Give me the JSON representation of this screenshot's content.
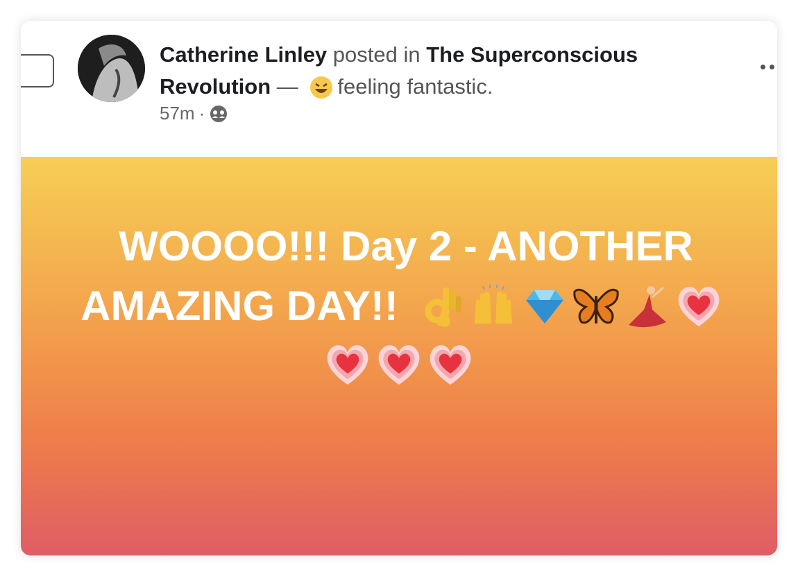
{
  "post": {
    "author": "Catherine Linley",
    "posted_in_text": " posted in ",
    "group": "The Superconscious Revolution",
    "dash": " — ",
    "feeling": "feeling fantastic.",
    "time": "57m",
    "separator": "·",
    "audience_icon": "group-audience-icon",
    "feeling_icon": "grinning-face-icon",
    "more_icon": "more-options-icon"
  },
  "status": {
    "line1": "WOOOO!!! Day 2 - ANOTHER",
    "line2": "AMAZING DAY!!",
    "emojis_line2": [
      "ok-hand-icon",
      "raised-hands-icon",
      "gem-icon",
      "butterfly-icon",
      "dancer-icon",
      "heart-icon"
    ],
    "emojis_line3": [
      "heart-icon",
      "heart-icon",
      "heart-icon"
    ],
    "background_gradient": [
      "#f6cf55",
      "#f3a04c",
      "#ee7c4a",
      "#df5d66"
    ]
  }
}
